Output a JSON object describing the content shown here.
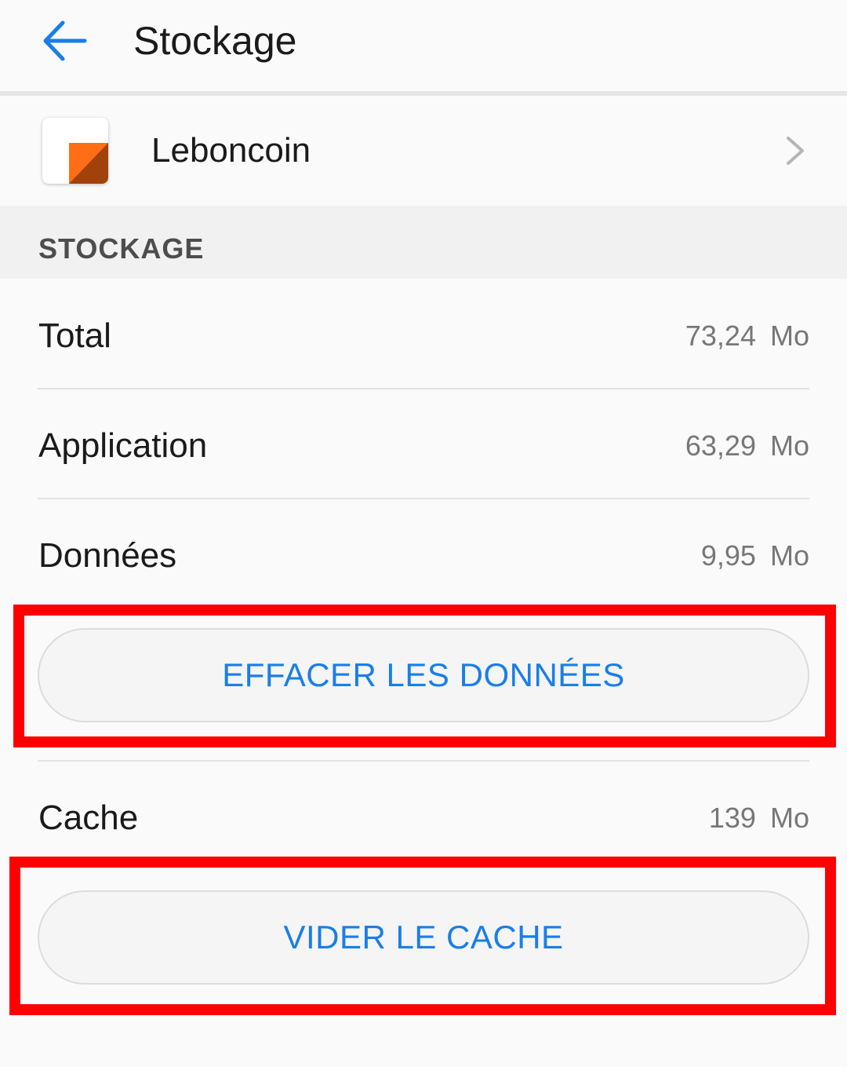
{
  "appbar": {
    "title": "Stockage",
    "back_icon": "arrow-left-icon",
    "accent_color": "#1a7ee8"
  },
  "app": {
    "name": "Leboncoin",
    "icon": "leboncoin-app-icon",
    "chevron_icon": "chevron-right-icon"
  },
  "section": {
    "header": "STOCKAGE"
  },
  "rows": [
    {
      "label": "Total",
      "value": "73,24",
      "unit": "Mo"
    },
    {
      "label": "Application",
      "value": "63,29",
      "unit": "Mo"
    },
    {
      "label": "Données",
      "value": "9,95",
      "unit": "Mo"
    },
    {
      "label": "Cache",
      "value": "139",
      "unit": "Mo"
    }
  ],
  "buttons": {
    "clear_data": "EFFACER LES DONNÉES",
    "clear_cache": "VIDER LE CACHE"
  },
  "highlight_color": "#ff0000"
}
